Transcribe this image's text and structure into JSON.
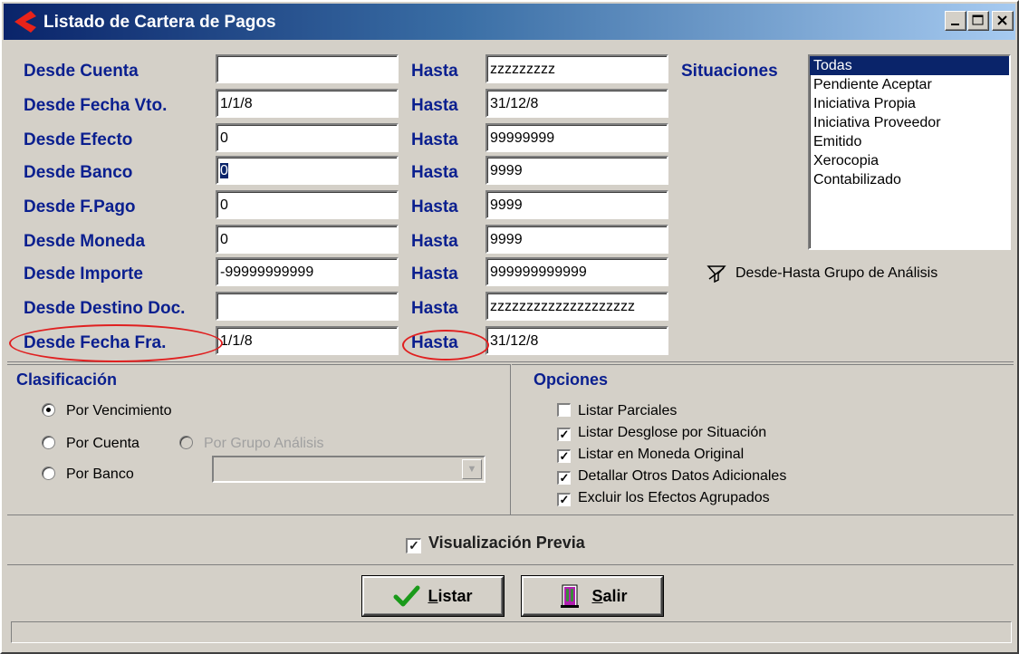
{
  "window": {
    "title": "Listado de Cartera de Pagos"
  },
  "filters": [
    {
      "label": "Desde Cuenta",
      "from": "",
      "hasta_label": "Hasta",
      "to": "zzzzzzzzz"
    },
    {
      "label": "Desde Fecha Vto.",
      "from": "1/1/8",
      "hasta_label": "Hasta",
      "to": "31/12/8"
    },
    {
      "label": "Desde Efecto",
      "from": "0",
      "hasta_label": "Hasta",
      "to": "99999999"
    },
    {
      "label": "Desde Banco",
      "from": "0",
      "hasta_label": "Hasta",
      "to": "9999"
    },
    {
      "label": "Desde F.Pago",
      "from": "0",
      "hasta_label": "Hasta",
      "to": "9999"
    },
    {
      "label": "Desde Moneda",
      "from": "0",
      "hasta_label": "Hasta",
      "to": "9999"
    },
    {
      "label": "Desde Importe",
      "from": "-99999999999",
      "hasta_label": "Hasta",
      "to": "999999999999"
    },
    {
      "label": "Desde Destino Doc.",
      "from": "",
      "hasta_label": "Hasta",
      "to": "zzzzzzzzzzzzzzzzzzzz"
    },
    {
      "label": "Desde Fecha Fra.",
      "from": "1/1/8",
      "hasta_label": "Hasta",
      "to": "31/12/8"
    }
  ],
  "situaciones": {
    "label": "Situaciones",
    "items": [
      "Todas",
      "Pendiente Aceptar",
      "Iniciativa Propia",
      "Iniciativa Proveedor",
      "Emitido",
      "Xerocopia",
      "Contabilizado"
    ],
    "selected": "Todas"
  },
  "grupo_analisis": {
    "label": "Desde-Hasta Grupo de Análisis",
    "icon": "filter-funnel-icon"
  },
  "clasificacion": {
    "title": "Clasificación",
    "por_vencimiento": "Por Vencimiento",
    "por_cuenta": "Por Cuenta",
    "por_grupo": "Por Grupo Análisis",
    "por_banco": "Por Banco",
    "selected": "Por Vencimiento",
    "banco_value": ""
  },
  "opciones": {
    "title": "Opciones",
    "items": [
      {
        "label": "Listar Parciales",
        "checked": false
      },
      {
        "label": "Listar Desglose por Situación",
        "checked": true
      },
      {
        "label": "Listar en Moneda Original",
        "checked": true
      },
      {
        "label": "Detallar Otros Datos Adicionales",
        "checked": true
      },
      {
        "label": "Excluir los Efectos Agrupados",
        "checked": true
      }
    ]
  },
  "visualizacion": {
    "label": "Visualización Previa",
    "checked": true
  },
  "buttons": {
    "listar_pre": "L",
    "listar_rest": "istar",
    "salir_pre": "S",
    "salir_rest": "alir"
  },
  "colors": {
    "label_blue": "#0a1f8f",
    "face": "#d4d0c8",
    "annotation_red": "#e02020"
  }
}
